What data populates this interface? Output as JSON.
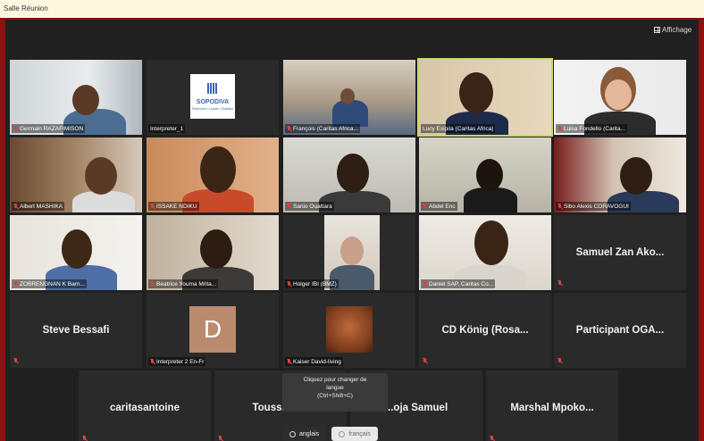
{
  "window": {
    "title": "Salle Réunion"
  },
  "toolbar": {
    "view_label": "Affichage"
  },
  "tiles": [
    {
      "name": "Germain RAZAFIMISON"
    },
    {
      "name": "Interpreter_1",
      "logo_text": "SOPODIVA",
      "logo_sub": "Partenaire | Leader | Solidaire"
    },
    {
      "name": "François (Caritas Africa..."
    },
    {
      "name": "Lucy Esipila (Caritas Africa)"
    },
    {
      "name": "Luisa Fondello (Carita..."
    },
    {
      "name": "Albert MASHIKA"
    },
    {
      "name": "ISSAKE NDIKU"
    },
    {
      "name": "Sanio Ouattara"
    },
    {
      "name": "Abdel Enc"
    },
    {
      "name": "Sibo Alexis CORAVOGUI"
    },
    {
      "name": "ZOBRENGNAN K Barn..."
    },
    {
      "name": "Beatrice Youma Mrita..."
    },
    {
      "name": "Holger IBI (BMZ)"
    },
    {
      "name": "Daniel SAP, Caritas Co..."
    },
    {
      "name": "Samuel Zan Ako..."
    },
    {
      "name": "Steve Bessafi"
    },
    {
      "name": "Interpreter 2 En-Fr",
      "initial": "D"
    },
    {
      "name": "Kaiser David-living"
    },
    {
      "name": "CD König (Rosa..."
    },
    {
      "name": "Participant OGA..."
    },
    {
      "name": "caritasantoine"
    },
    {
      "name": "Toussaint..."
    },
    {
      "name": "...oja Samuel"
    },
    {
      "name": "Marshal Mpoko..."
    }
  ],
  "tooltip": {
    "line1": "Cliquez pour changer de",
    "line2": "langue",
    "line3": "(Ctrl+Shift+C)"
  },
  "languages": {
    "english": "anglais",
    "french": "français"
  },
  "icons": [
    "grid-view-icon",
    "muted-mic-icon",
    "globe-icon"
  ],
  "colors": {
    "window_border": "#8c1212",
    "stage_bg": "#202020",
    "active_speaker": "#c8d86a",
    "muted_mic": "#e04040"
  }
}
